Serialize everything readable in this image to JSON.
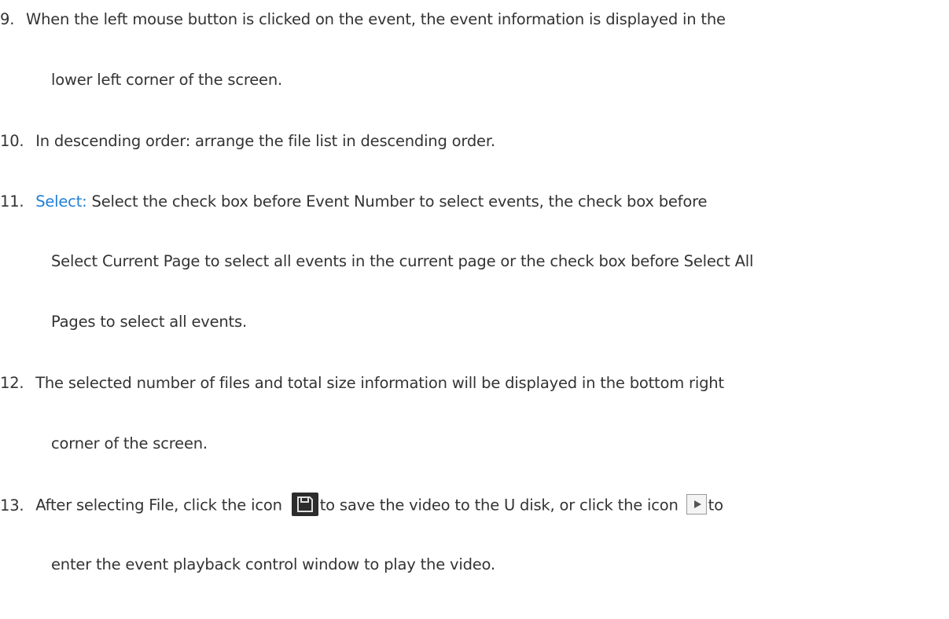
{
  "items": [
    {
      "number": "9.",
      "lines": [
        "When the left mouse button is clicked on the event, the event information is displayed in the",
        "lower left corner of the screen."
      ]
    },
    {
      "number": "10.",
      "lines": [
        "In descending order: arrange the file list in descending order."
      ]
    },
    {
      "number": "11.",
      "highlight": "Select:",
      "lines": [
        " Select the check box before Event Number to select events, the check box before",
        "Select Current Page to select all events in the current page or the check box before Select All",
        "Pages to select all events."
      ]
    },
    {
      "number": "12.",
      "lines": [
        "The selected number of files and total size information will be displayed in the bottom right",
        "corner of the screen."
      ]
    },
    {
      "number": "13.",
      "line1_a": "After selecting File, click the icon",
      "line1_b": "to save the video to the U disk, or click the icon",
      "line1_c": "to",
      "line2": "enter the event playback control window to play the video.",
      "icons": [
        "save-icon",
        "play-icon"
      ]
    }
  ],
  "colors": {
    "text": "#333333",
    "highlight": "#1f7fd6",
    "save_icon_bg": "#2c2c2c"
  }
}
